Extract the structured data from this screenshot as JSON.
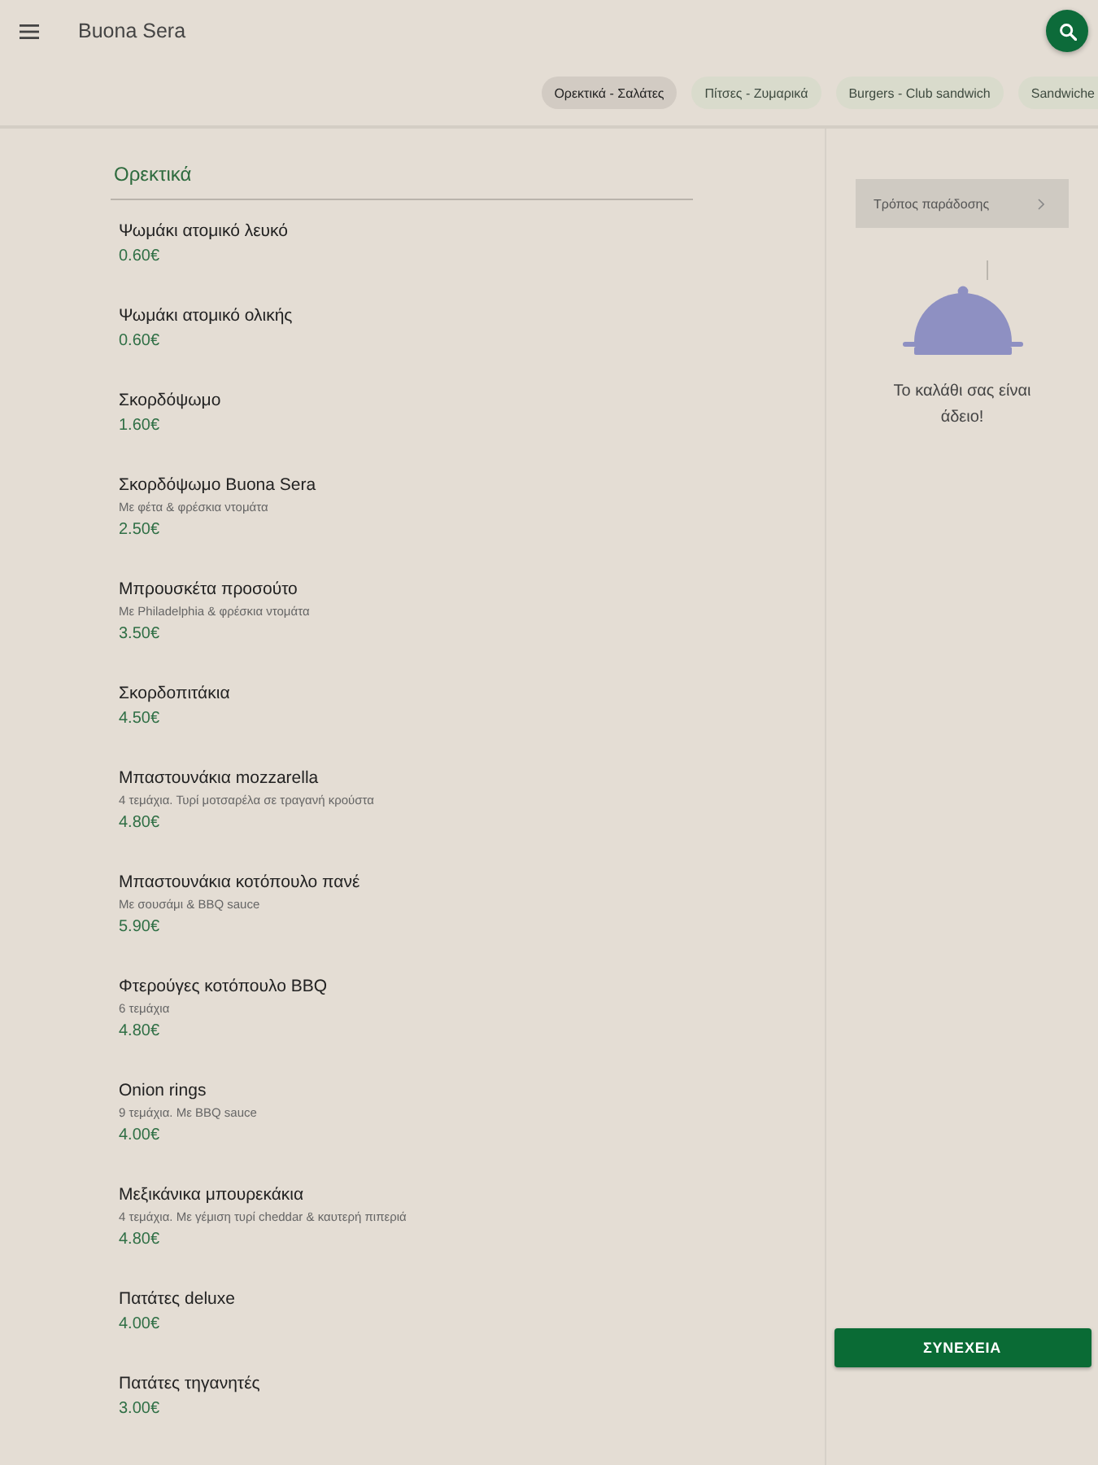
{
  "app_bar": {
    "title": "Buona Sera"
  },
  "categories": [
    {
      "label": "Ορεκτικά - Σαλάτες",
      "selected": true
    },
    {
      "label": "Πίτσες - Ζυμαρικά",
      "selected": false
    },
    {
      "label": "Burgers - Club sandwich",
      "selected": false
    },
    {
      "label": "Sandwiche",
      "selected": false
    }
  ],
  "menu": {
    "section_title": "Ορεκτικά",
    "items": [
      {
        "name": "Ψωμάκι ατομικό λευκό",
        "price": "0.60€"
      },
      {
        "name": "Ψωμάκι ατομικό ολικής",
        "price": "0.60€"
      },
      {
        "name": "Σκορδόψωμο",
        "price": "1.60€"
      },
      {
        "name": "Σκορδόψωμο Buona Sera",
        "description": "Με φέτα & φρέσκια ντομάτα",
        "price": "2.50€"
      },
      {
        "name": "Μπρουσκέτα προσούτο",
        "description": "Με Philadelphia & φρέσκια ντομάτα",
        "price": "3.50€"
      },
      {
        "name": "Σκορδοπιτάκια",
        "price": "4.50€"
      },
      {
        "name": "Μπαστουνάκια mozzarella",
        "description": "4 τεμάχια. Τυρί μοτσαρέλα σε τραγανή κρούστα",
        "price": "4.80€"
      },
      {
        "name": "Μπαστουνάκια κοτόπουλο πανέ",
        "description": "Με σουσάμι & BBQ sauce",
        "price": "5.90€"
      },
      {
        "name": "Φτερούγες κοτόπουλο BBQ",
        "description": "6 τεμάχια",
        "price": "4.80€"
      },
      {
        "name": "Onion rings",
        "description": "9 τεμάχια. Με BBQ sauce",
        "price": "4.00€"
      },
      {
        "name": "Μεξικάνικα μπουρεκάκια",
        "description": "4 τεμάχια. Με γέμιση τυρί cheddar & καυτερή πιπεριά",
        "price": "4.80€"
      },
      {
        "name": "Πατάτες deluxe",
        "price": "4.00€"
      },
      {
        "name": "Πατάτες τηγανητές",
        "price": "3.00€"
      }
    ]
  },
  "cart": {
    "delivery_button": "Τρόπος παράδοσης",
    "empty_message": "Το καλάθι σας είναι άδειο!",
    "continue_button": "ΣΥΝΕΧΕΙΑ"
  }
}
